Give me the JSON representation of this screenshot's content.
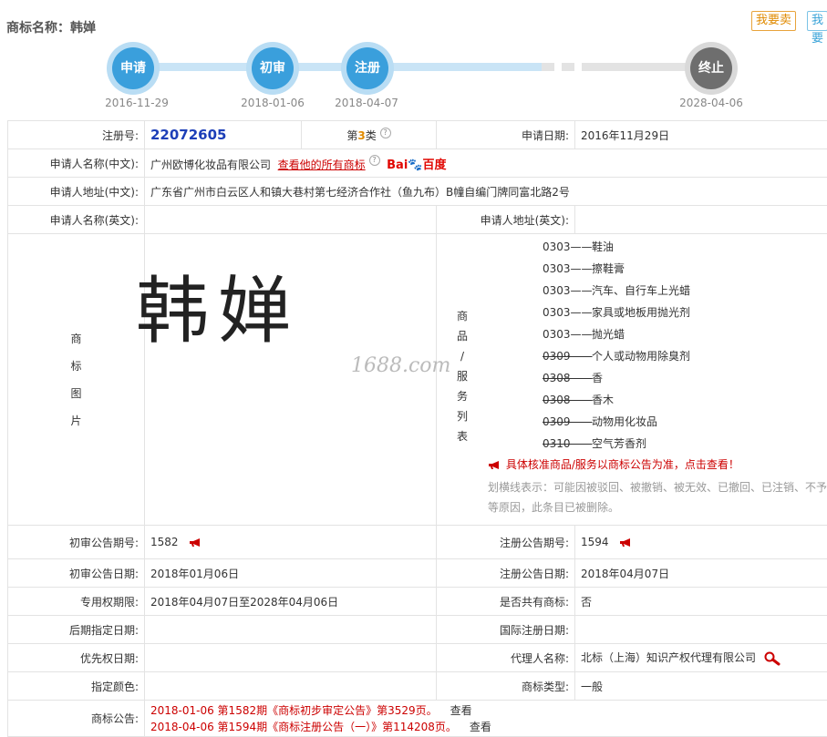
{
  "header": {
    "title": "商标名称：韩婵",
    "sell_button": "我要卖",
    "buy_button": "我要"
  },
  "timeline": {
    "steps": [
      {
        "label": "申请",
        "date": "2016-11-29"
      },
      {
        "label": "初审",
        "date": "2018-01-06"
      },
      {
        "label": "注册",
        "date": "2018-04-07"
      },
      {
        "label": "终止",
        "date": "2028-04-06"
      }
    ]
  },
  "info": {
    "reg_no_label": "注册号:",
    "reg_no": "22072605",
    "class_prefix": "第",
    "class_num": "3",
    "class_suffix": "类",
    "apply_date_label": "申请日期:",
    "apply_date": "2016年11月29日",
    "applicant_cn_label": "申请人名称(中文):",
    "applicant_cn": "广州欧博化妆品有限公司",
    "all_marks_link": "查看他的所有商标",
    "baidu_a": "Bai",
    "baidu_b": "百度",
    "address_cn_label": "申请人地址(中文):",
    "address_cn": "广东省广州市白云区人和镇大巷村第七经济合作社（鱼九布）B幢自编门牌同富北路2号",
    "applicant_en_label": "申请人名称(英文):",
    "applicant_en": "",
    "address_en_label": "申请人地址(英文):",
    "address_en": "",
    "image_label": [
      "商",
      "标",
      "图",
      "片"
    ],
    "mark_text": "韩婵",
    "watermark": "1688.com",
    "goods_label": [
      "商",
      "品",
      "/",
      "服",
      "务",
      "列",
      "表"
    ],
    "goods": [
      {
        "code": "0303——",
        "name": "鞋油",
        "struck": false
      },
      {
        "code": "0303——",
        "name": "擦鞋膏",
        "struck": false
      },
      {
        "code": "0303——",
        "name": "汽车、自行车上光蜡",
        "struck": false
      },
      {
        "code": "0303——",
        "name": "家具或地板用抛光剂",
        "struck": false
      },
      {
        "code": "0303——",
        "name": "抛光蜡",
        "struck": false
      },
      {
        "code": "0309——",
        "name": "个人或动物用除臭剂",
        "struck": true
      },
      {
        "code": "0308——",
        "name": "香",
        "struck": true
      },
      {
        "code": "0308——",
        "name": "香木",
        "struck": true
      },
      {
        "code": "0309——",
        "name": "动物用化妆品",
        "struck": true
      },
      {
        "code": "0310——",
        "name": "空气芳香剂",
        "struck": true
      }
    ],
    "goods_notice": "具体核准商品/服务以商标公告为准，点击查看！",
    "strike_note": "划横线表示：可能因被驳回、被撤销、被无效、已撤回、已注销、不予等原因，此条目已被删除。",
    "prelim_no_label": "初审公告期号:",
    "prelim_no": "1582",
    "reg_notice_no_label": "注册公告期号:",
    "reg_notice_no": "1594",
    "prelim_date_label": "初审公告日期:",
    "prelim_date": "2018年01月06日",
    "reg_notice_date_label": "注册公告日期:",
    "reg_notice_date": "2018年04月07日",
    "exclusive_label": "专用权期限:",
    "exclusive": "2018年04月07日至2028年04月06日",
    "shared_label": "是否共有商标:",
    "shared": "否",
    "later_label": "后期指定日期:",
    "later": "",
    "intl_label": "国际注册日期:",
    "intl": "",
    "priority_label": "优先权日期:",
    "priority": "",
    "agent_label": "代理人名称:",
    "agent": "北标（上海）知识产权代理有限公司",
    "color_label": "指定颜色:",
    "color": "",
    "type_label": "商标类型:",
    "type": "一般",
    "announce_label": "商标公告:",
    "announcements": [
      {
        "text": "2018-01-06 第1582期《商标初步审定公告》第3529页。",
        "view": "查看"
      },
      {
        "text": "2018-04-06 第1594期《商标注册公告（一）》第114208页。",
        "view": "查看"
      }
    ]
  },
  "colors": {
    "accent_blue": "#3a9fdc",
    "red": "#cc0000",
    "orange": "#e08a00"
  }
}
